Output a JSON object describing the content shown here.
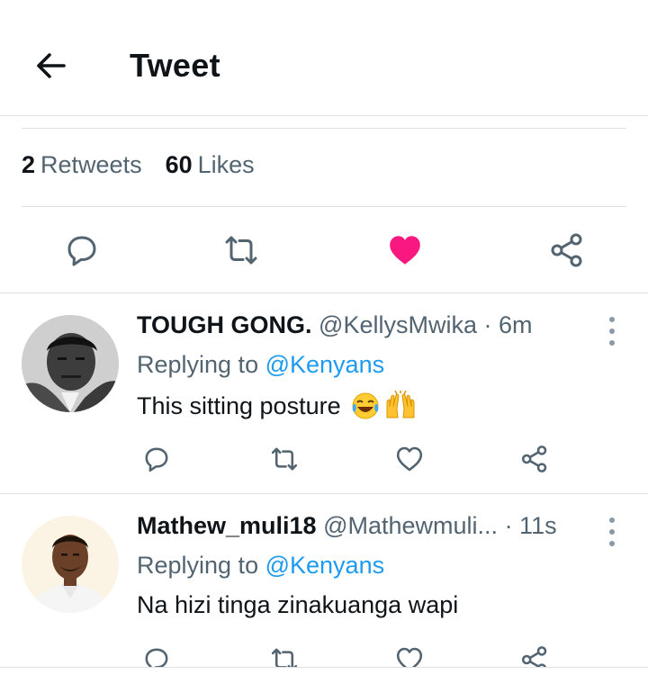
{
  "header": {
    "title": "Tweet"
  },
  "stats": {
    "retweets_count": "2",
    "retweets_label": "Retweets",
    "likes_count": "60",
    "likes_label": "Likes"
  },
  "colors": {
    "like_active": "#f91880",
    "mention": "#1d9bf0",
    "muted": "#536471"
  },
  "replies": [
    {
      "name": "TOUGH GONG.",
      "handle": "@KellysMwika",
      "time": "· 6m",
      "replying_prefix": "Replying to",
      "replying_to": "@Kenyans",
      "text": "This sitting posture",
      "emojis": [
        "face-with-tears-of-joy",
        "raising-hands"
      ]
    },
    {
      "name": "Mathew_muli18",
      "handle": "@Mathewmuli...",
      "time": "· 11s",
      "replying_prefix": "Replying to",
      "replying_to": "@Kenyans",
      "text": "Na hizi tinga zinakuanga wapi"
    }
  ]
}
